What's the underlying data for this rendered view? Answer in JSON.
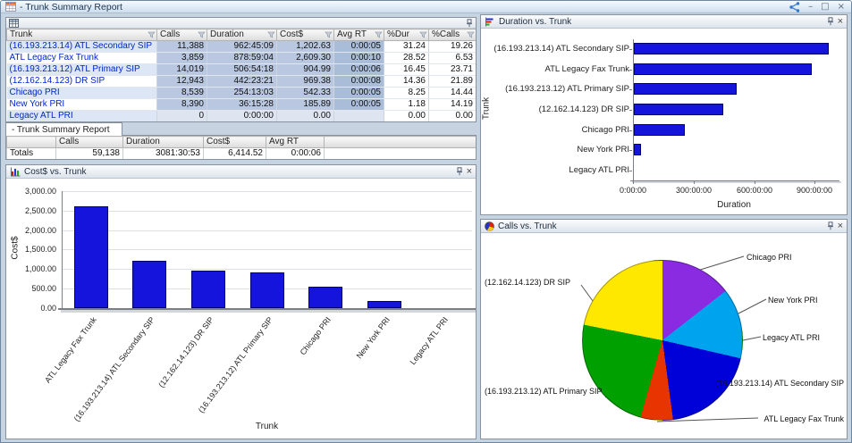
{
  "window": {
    "title": "- Trunk Summary Report",
    "controls": {
      "minimize": "–",
      "maximize": "□",
      "close": "×"
    }
  },
  "summary_tab": {
    "label": "- Trunk Summary Report"
  },
  "table": {
    "columns": [
      "Trunk",
      "Calls",
      "Duration",
      "Cost$",
      "Avg RT",
      "%Dur",
      "%Calls"
    ],
    "rows": [
      {
        "trunk": "(16.193.213.14) ATL Secondary SIP",
        "calls": "11,388",
        "duration": "962:45:09",
        "cost": "1,202.63",
        "avg_rt": "0:00:05",
        "pct_dur": "31.24",
        "pct_calls": "19.26"
      },
      {
        "trunk": "ATL Legacy Fax Trunk",
        "calls": "3,859",
        "duration": "878:59:04",
        "cost": "2,609.30",
        "avg_rt": "0:00:10",
        "pct_dur": "28.52",
        "pct_calls": "6.53"
      },
      {
        "trunk": "(16.193.213.12) ATL Primary SIP",
        "calls": "14,019",
        "duration": "506:54:18",
        "cost": "904.99",
        "avg_rt": "0:00:06",
        "pct_dur": "16.45",
        "pct_calls": "23.71"
      },
      {
        "trunk": "(12.162.14.123) DR SIP",
        "calls": "12,943",
        "duration": "442:23:21",
        "cost": "969.38",
        "avg_rt": "0:00:08",
        "pct_dur": "14.36",
        "pct_calls": "21.89"
      },
      {
        "trunk": "Chicago PRI",
        "calls": "8,539",
        "duration": "254:13:03",
        "cost": "542.33",
        "avg_rt": "0:00:05",
        "pct_dur": "8.25",
        "pct_calls": "14.44"
      },
      {
        "trunk": "New York PRI",
        "calls": "8,390",
        "duration": "36:15:28",
        "cost": "185.89",
        "avg_rt": "0:00:05",
        "pct_dur": "1.18",
        "pct_calls": "14.19"
      },
      {
        "trunk": "Legacy ATL PRI",
        "calls": "0",
        "duration": "0:00:00",
        "cost": "0.00",
        "avg_rt": "",
        "pct_dur": "0.00",
        "pct_calls": "0.00"
      }
    ]
  },
  "totals": {
    "columns": [
      "Calls",
      "Duration",
      "Cost$",
      "Avg RT"
    ],
    "row_label": "Totals",
    "calls": "59,138",
    "duration": "3081:30:53",
    "cost": "6,414.52",
    "avg_rt": "0:00:06"
  },
  "chart_data": [
    {
      "type": "bar",
      "title": "Cost$ vs. Trunk",
      "xlabel": "Trunk",
      "ylabel": "Cost$",
      "ylim": [
        0,
        3000
      ],
      "yticks": [
        "0.00",
        "500.00",
        "1,000.00",
        "1,500.00",
        "2,000.00",
        "2,500.00",
        "3,000.00"
      ],
      "categories": [
        "ATL Legacy Fax Trunk",
        "(16.193.213.14) ATL Secondary SIP",
        "(12.162.14.123) DR SIP",
        "(16.193.213.12) ATL Primary SIP",
        "Chicago PRI",
        "New York PRI",
        "Legacy ATL PRI"
      ],
      "values": [
        2609.3,
        1202.63,
        969.38,
        904.99,
        542.33,
        185.89,
        0
      ],
      "bar_color": "#1414dd",
      "grid": true,
      "legend": "none"
    },
    {
      "type": "bar",
      "orientation": "horizontal",
      "title": "Duration vs. Trunk",
      "xlabel": "Duration",
      "ylabel": "Trunk",
      "xlim_hours": [
        0,
        1000
      ],
      "xticks": [
        "0:00:00",
        "300:00:00",
        "600:00:00",
        "900:00:00"
      ],
      "xtick_hours": [
        0,
        300,
        600,
        900
      ],
      "categories": [
        "(16.193.213.14) ATL Secondary SIP",
        "ATL Legacy Fax Trunk",
        "(16.193.213.12) ATL Primary SIP",
        "(12.162.14.123) DR SIP",
        "Chicago PRI",
        "New York PRI",
        "Legacy ATL PRI"
      ],
      "values_hours": [
        962.75,
        878.98,
        506.91,
        442.39,
        254.22,
        36.26,
        0
      ],
      "values_hms": [
        "962:45:09",
        "878:59:04",
        "506:54:18",
        "442:23:21",
        "254:13:03",
        "36:15:28",
        "0:00:00"
      ],
      "bar_color": "#1414dd",
      "grid": false,
      "legend": "none"
    },
    {
      "type": "pie",
      "title": "Calls vs. Trunk",
      "legend": "callout-labels",
      "slices": [
        {
          "label": "Chicago PRI",
          "value": 8539,
          "color": "#8a2be2"
        },
        {
          "label": "New York PRI",
          "value": 8390,
          "color": "#00a4ee"
        },
        {
          "label": "Legacy ATL PRI",
          "value": 0,
          "color": "#888888"
        },
        {
          "label": "(16.193.213.14) ATL Secondary SIP",
          "value": 11388,
          "color": "#0000d8"
        },
        {
          "label": "ATL Legacy Fax Trunk",
          "value": 3859,
          "color": "#e83400"
        },
        {
          "label": "(16.193.213.12) ATL Primary SIP",
          "value": 14019,
          "color": "#00a000"
        },
        {
          "label": "(12.162.14.123) DR SIP",
          "value": 12943,
          "color": "#ffe800"
        }
      ]
    }
  ]
}
